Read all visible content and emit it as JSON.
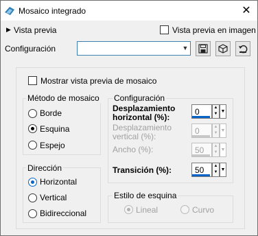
{
  "window": {
    "title": "Mosaico integrado",
    "close_glyph": "✕"
  },
  "top": {
    "preview_toggle": "Vista previa",
    "preview_in_image": "Vista previa en imagen",
    "config_label": "Configuración",
    "config_value": ""
  },
  "toolbar": {
    "save_icon": "save-icon",
    "presets_icon": "cube-icon",
    "reset_icon": "reset-icon"
  },
  "panel": {
    "show_tile_preview": "Mostrar vista previa de mosaico",
    "method": {
      "title": "Método de mosaico",
      "options": [
        "Borde",
        "Esquina",
        "Espejo"
      ],
      "selected": "Esquina"
    },
    "config": {
      "title": "Configuración",
      "h_offset_label_1": "Desplazamiento",
      "h_offset_label_2": "horizontal (%):",
      "h_offset_value": "0",
      "v_offset_label_1": "Desplazamiento",
      "v_offset_label_2": "vertical (%):",
      "v_offset_value": "0",
      "width_label": "Ancho (%):",
      "width_value": "50",
      "transition_label": "Transición (%):",
      "transition_value": "50"
    },
    "direction": {
      "title": "Dirección",
      "options": [
        "Horizontal",
        "Vertical",
        "Bidireccional"
      ],
      "selected": "Horizontal"
    },
    "corner_style": {
      "title": "Estilo de esquina",
      "options": [
        "Lineal",
        "Curvo"
      ],
      "selected": "Lineal"
    }
  },
  "colors": {
    "accent": "#0a64c8",
    "background": "#f0f0f0"
  }
}
